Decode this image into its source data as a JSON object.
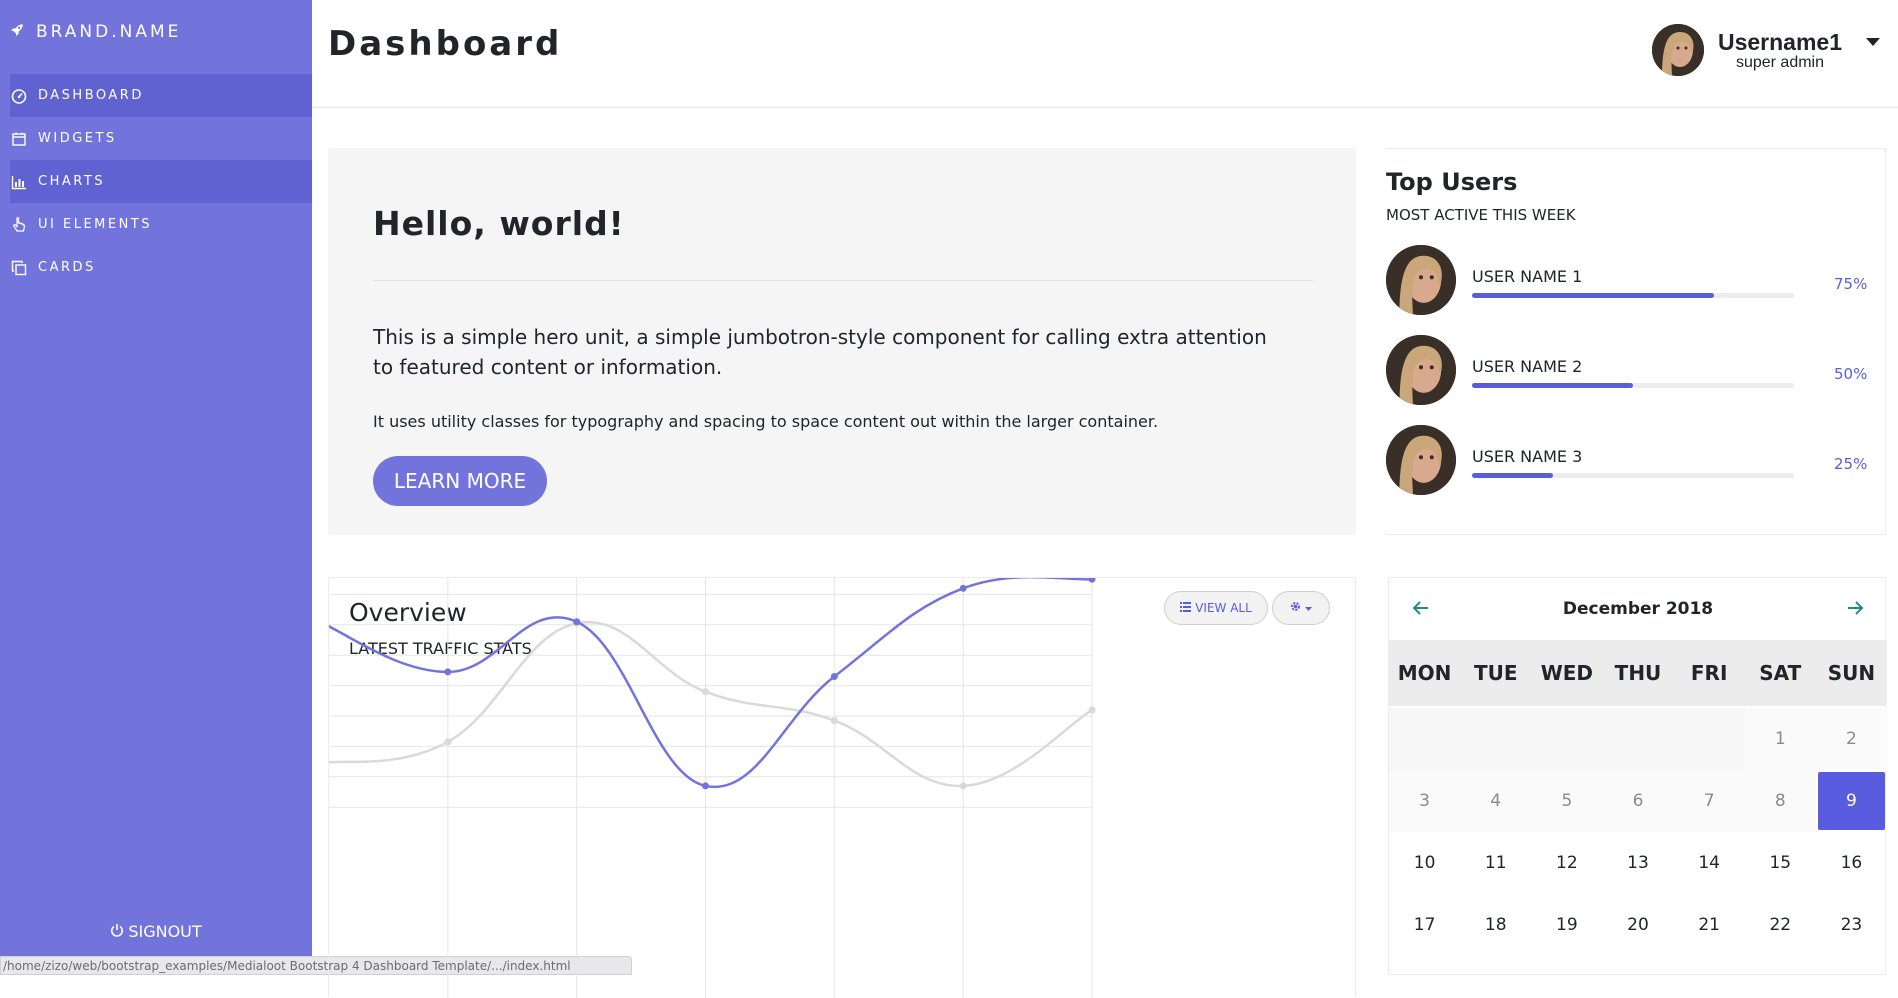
{
  "brand": {
    "name": "BRAND.NAME",
    "icon": "rocket-icon"
  },
  "sidebar": {
    "items": [
      {
        "label": "DASHBOARD",
        "icon": "tachometer-icon",
        "active": true
      },
      {
        "label": "WIDGETS",
        "icon": "calendar-icon",
        "active": false
      },
      {
        "label": "CHARTS",
        "icon": "bar-chart-icon",
        "active": true
      },
      {
        "label": "UI ELEMENTS",
        "icon": "hand-pointer-icon",
        "active": false
      },
      {
        "label": "CARDS",
        "icon": "clone-icon",
        "active": false
      }
    ],
    "signout_label": "SIGNOUT"
  },
  "statusbar": {
    "text": "/home/zizo/web/bootstrap_examples/Medialoot Bootstrap 4 Dashboard Template/.../index.html"
  },
  "header": {
    "title": "Dashboard",
    "username": "Username1",
    "role": "super admin"
  },
  "hero": {
    "heading": "Hello, world!",
    "lead": "This is a simple hero unit, a simple jumbotron-style component for calling extra attention to featured content or information.",
    "text": "It uses utility classes for typography and spacing to space content out within the larger container.",
    "button_label": "LEARN MORE"
  },
  "overview": {
    "title": "Overview",
    "subtitle": "LATEST TRAFFIC STATS",
    "view_all_label": "VIEW ALL"
  },
  "chart_data": {
    "type": "line",
    "x": [
      0,
      1,
      2,
      3,
      4,
      5,
      6
    ],
    "ylim": [
      100,
      900
    ],
    "yticks": [
      900,
      800,
      700,
      600,
      500,
      400,
      300,
      200,
      100
    ],
    "grid": true,
    "series": [
      {
        "values": [
          710,
          545,
          710,
          170,
          530,
          820,
          850
        ],
        "color": "#7274dc"
      },
      {
        "values": [
          245,
          315,
          705,
          480,
          385,
          170,
          420
        ],
        "color": "#d9d9d9"
      }
    ]
  },
  "top_users": {
    "title": "Top Users",
    "subtitle": "MOST ACTIVE THIS WEEK",
    "users": [
      {
        "name": "USER NAME 1",
        "percent": "75%",
        "value": 0.75
      },
      {
        "name": "USER NAME 2",
        "percent": "50%",
        "value": 0.5
      },
      {
        "name": "USER NAME 3",
        "percent": "25%",
        "value": 0.25
      }
    ]
  },
  "calendar": {
    "month": "December 2018",
    "weekdays": [
      "MON",
      "TUE",
      "WED",
      "THU",
      "FRI",
      "SAT",
      "SUN"
    ],
    "days": [
      "",
      "",
      "",
      "",
      "",
      "1",
      "2",
      "3",
      "4",
      "5",
      "6",
      "7",
      "8",
      "9",
      "10",
      "11",
      "12",
      "13",
      "14",
      "15",
      "16",
      "17",
      "18",
      "19",
      "20",
      "21",
      "22",
      "23"
    ],
    "today": "9",
    "muted_through": "9",
    "accent": "#5a5ce0"
  }
}
